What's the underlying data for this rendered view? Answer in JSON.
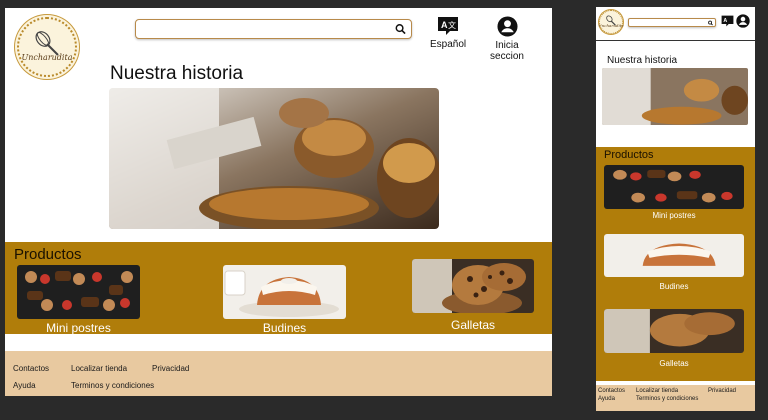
{
  "brand": {
    "name": "Uncharudita"
  },
  "search": {
    "placeholder": "",
    "value": ""
  },
  "header": {
    "language_label": "Español",
    "login_label": "Inicia seccion"
  },
  "story": {
    "title": "Nuestra historia",
    "image": "bakery-baskets-photo"
  },
  "products": {
    "title": "Productos",
    "items": [
      {
        "label": "Mini postres",
        "image": "mini-desserts-photo"
      },
      {
        "label": "Budines",
        "image": "bundt-cake-photo"
      },
      {
        "label": "Galletas",
        "image": "cookies-photo"
      }
    ]
  },
  "footer": {
    "contactos": "Contactos",
    "localizar": "Localizar tienda",
    "privacidad": "Privacidad",
    "ayuda": "Ayuda",
    "terminos": "Terminos y condiciones"
  },
  "colors": {
    "page_bg": "#2a2a2a",
    "products_band": "#b07d0a",
    "footer_bg": "#e8c9a0",
    "search_border": "#b88a4a"
  },
  "icons": [
    "search-icon",
    "translate-icon",
    "account-icon",
    "whisk-logo-icon"
  ]
}
